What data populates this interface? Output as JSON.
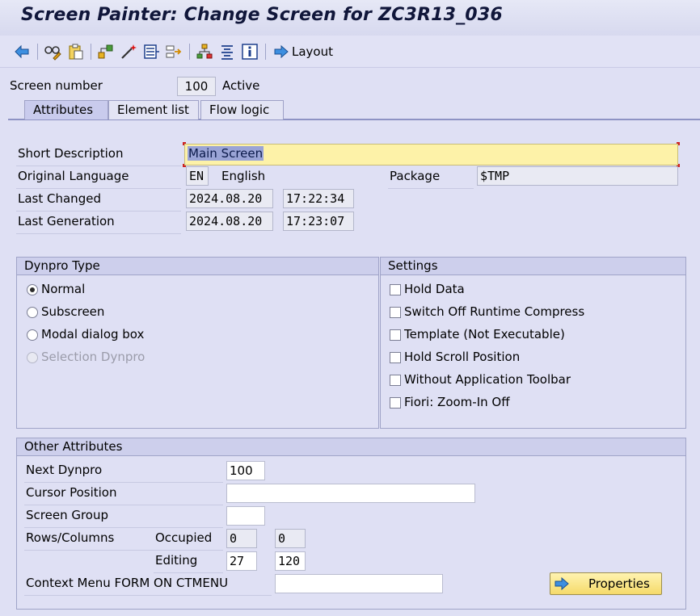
{
  "window": {
    "title": "Screen Painter: Change Screen for ZC3R13_036"
  },
  "toolbar": {
    "icons": [
      "back-icon",
      "glasses-pencil-icon",
      "clipboard-icon",
      "hierarchy-icon",
      "magic-wand-icon",
      "element-list-icon",
      "flow-icon",
      "org-tree-icon",
      "align-icon",
      "info-icon"
    ],
    "layout_label": "Layout"
  },
  "header": {
    "screen_number_label": "Screen number",
    "screen_number": "100",
    "status": "Active"
  },
  "tabs": [
    {
      "label": "Attributes"
    },
    {
      "label": "Element list"
    },
    {
      "label": "Flow logic"
    }
  ],
  "attributes": {
    "short_desc_label": "Short Description",
    "short_desc": "Main Screen",
    "orig_lang_label": "Original Language",
    "orig_lang_code": "EN",
    "orig_lang_name": "English",
    "package_label": "Package",
    "package": "$TMP",
    "last_changed_label": "Last Changed",
    "last_changed_date": "2024.08.20",
    "last_changed_time": "17:22:34",
    "last_gen_label": "Last Generation",
    "last_gen_date": "2024.08.20",
    "last_gen_time": "17:23:07"
  },
  "dynpro_type": {
    "title": "Dynpro Type",
    "options": [
      {
        "label": "Normal",
        "selected": true,
        "enabled": true
      },
      {
        "label": "Subscreen",
        "selected": false,
        "enabled": true
      },
      {
        "label": "Modal dialog box",
        "selected": false,
        "enabled": true
      },
      {
        "label": "Selection Dynpro",
        "selected": false,
        "enabled": false
      }
    ]
  },
  "settings": {
    "title": "Settings",
    "options": [
      {
        "label": "Hold Data",
        "checked": false
      },
      {
        "label": "Switch Off Runtime Compress",
        "checked": false
      },
      {
        "label": "Template (Not Executable)",
        "checked": false
      },
      {
        "label": "Hold Scroll Position",
        "checked": false
      },
      {
        "label": "Without Application Toolbar",
        "checked": false
      },
      {
        "label": "Fiori: Zoom-In Off",
        "checked": false
      }
    ]
  },
  "other": {
    "title": "Other Attributes",
    "next_dynpro_label": "Next Dynpro",
    "next_dynpro": "100",
    "cursor_pos_label": "Cursor Position",
    "cursor_pos": "",
    "screen_group_label": "Screen Group",
    "screen_group": "",
    "rows_cols_label": "Rows/Columns",
    "occupied_label": "Occupied",
    "occupied_rows": "0",
    "occupied_cols": "0",
    "editing_label": "Editing",
    "editing_rows": "27",
    "editing_cols": "120",
    "context_menu_label": "Context Menu FORM ON CTMENU",
    "context_menu": "",
    "properties_label": "Properties"
  }
}
